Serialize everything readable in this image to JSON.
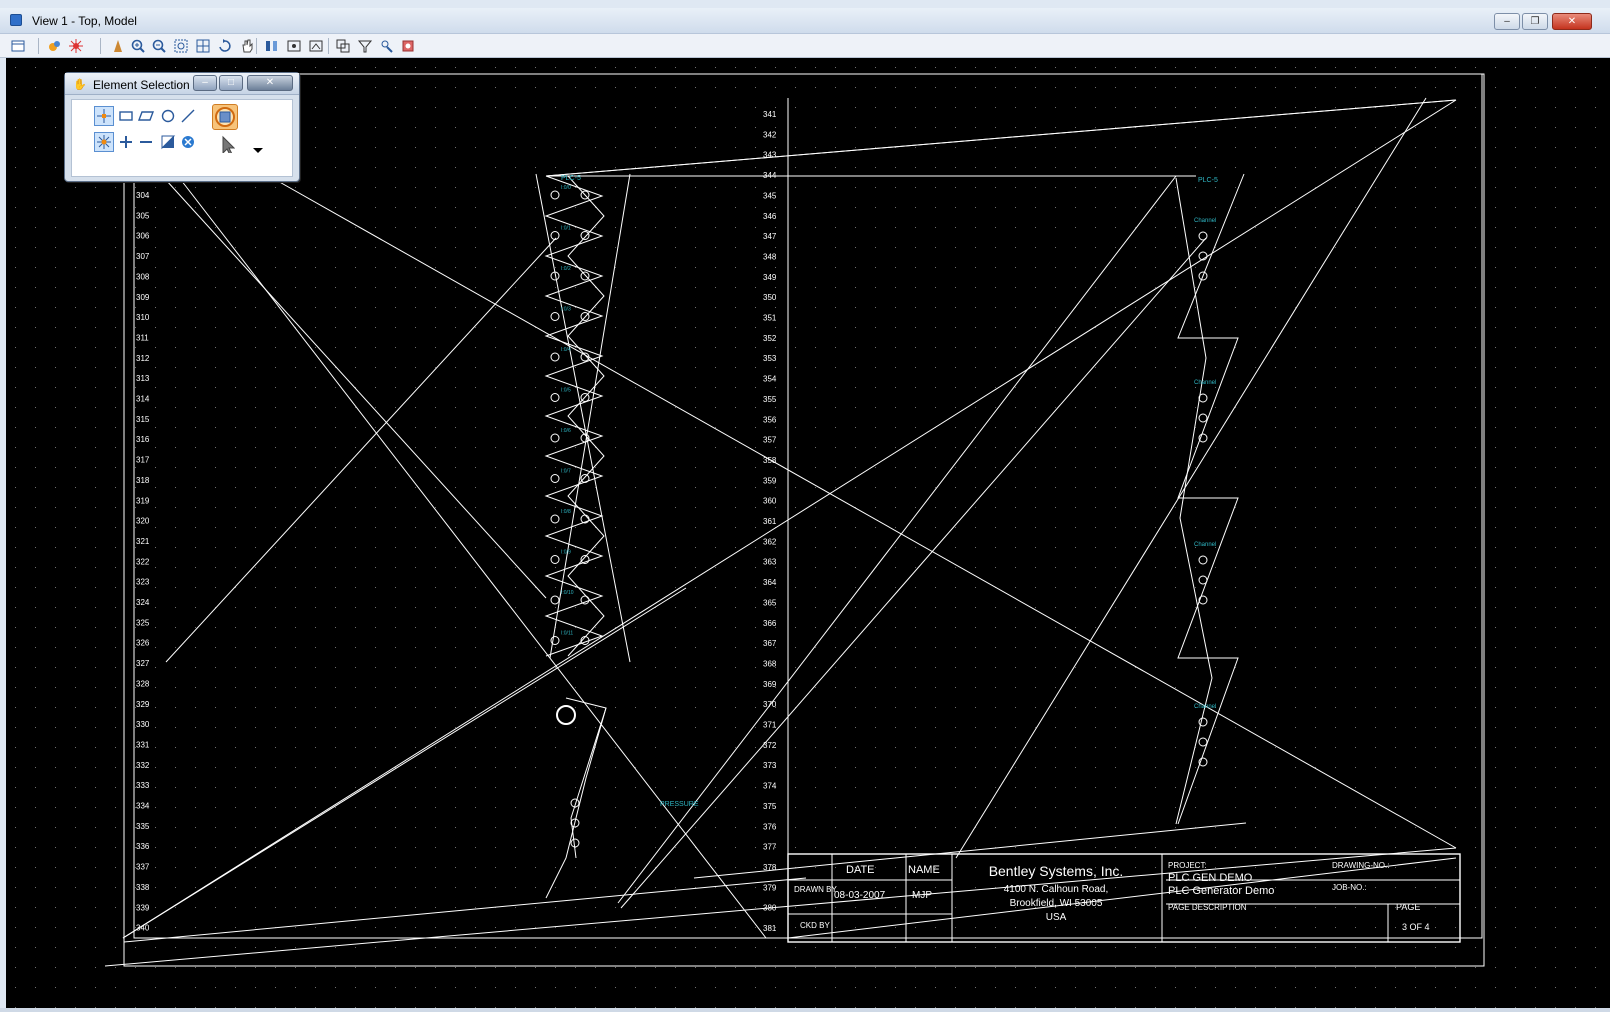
{
  "window": {
    "title": "View 1 - Top, Model",
    "controls": [
      "minimize",
      "restore",
      "close"
    ]
  },
  "toolbar": {
    "icons": [
      "view-groups-icon",
      "view-attributes-icon",
      "display-style-icon",
      "update-view-icon",
      "zoom-in-icon",
      "zoom-out-icon",
      "window-area-icon",
      "fit-view-icon",
      "rotate-view-icon",
      "pan-view-icon",
      "view-previous-icon",
      "view-next-icon",
      "copy-view-icon",
      "clip-volume-icon",
      "clip-mask-icon",
      "camera-icon",
      "display-set-icon"
    ]
  },
  "element_selection": {
    "title": "Element Selection",
    "tools": [
      "individual-selection-icon",
      "block-selection-icon",
      "shape-selection-icon",
      "circle-selection-icon",
      "line-selection-icon",
      "new-selection-icon",
      "add-selection-icon",
      "subtract-selection-icon",
      "invert-selection-icon",
      "clear-selection-icon",
      "select-all-icon",
      "selection-filter-icon",
      "more-options-icon"
    ]
  },
  "drawing": {
    "rung_numbers_left": [
      "304",
      "305",
      "306",
      "307",
      "308",
      "309",
      "310",
      "311",
      "312",
      "313",
      "314",
      "315",
      "316",
      "317",
      "318",
      "319",
      "320",
      "321",
      "322",
      "323",
      "324",
      "325",
      "326",
      "327",
      "328",
      "329",
      "330",
      "331",
      "332",
      "333",
      "334",
      "335",
      "336",
      "337",
      "338",
      "339",
      "340"
    ],
    "rung_numbers_right": [
      "341",
      "342",
      "343",
      "344",
      "345",
      "346",
      "347",
      "348",
      "349",
      "350",
      "351",
      "352",
      "353",
      "354",
      "355",
      "356",
      "357",
      "358",
      "359",
      "360",
      "361",
      "362",
      "363",
      "364",
      "365",
      "366",
      "367",
      "368",
      "369",
      "370",
      "371",
      "372",
      "373",
      "374",
      "375",
      "376",
      "377",
      "378",
      "379",
      "380",
      "381"
    ],
    "labels": {
      "plc_left": "PLC-5",
      "plc_right": "PLC-5",
      "pressure": "PRESSURE"
    },
    "title_block": {
      "date_header": "DATE",
      "name_header": "NAME",
      "drawn_by": "DRAWN BY",
      "ckd_by": "CKD BY",
      "date_value": "08-03-2007",
      "name_value": "MJP",
      "company": "Bentley Systems, Inc.",
      "address1": "4100 N. Calhoun Road,",
      "address2": "Brookfield, WI 53005",
      "country": "USA",
      "project_label": "PROJECT:",
      "project_value": "PLC GEN DEMO",
      "project_sub": "PLC Generator Demo",
      "page_desc_label": "PAGE DESCRIPTION",
      "drawing_no_label": "DRAWING-NO.:",
      "job_no_label": "JOB-NO.:",
      "page_label": "PAGE",
      "page_value": "3 OF 4"
    },
    "colors": {
      "line": "#ffffff",
      "annotation": "#2fb6c3",
      "background": "#000000"
    }
  }
}
